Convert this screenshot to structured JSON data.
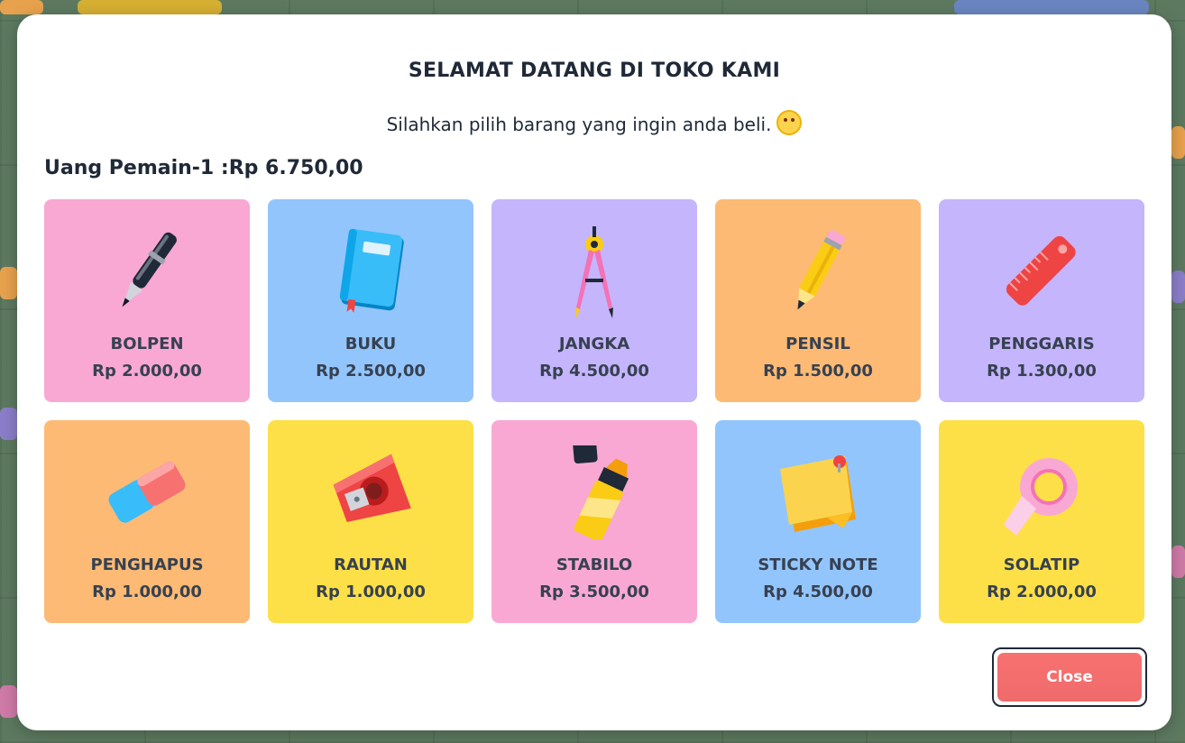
{
  "shop": {
    "title": "SELAMAT DATANG DI TOKO KAMI",
    "subtitle": "Silahkan pilih barang yang ingin anda beli.",
    "money_label": "Uang Pemain-1 :Rp 6.750,00",
    "close_label": "Close"
  },
  "items": [
    {
      "name": "BOLPEN",
      "price": "Rp 2.000,00",
      "color": "#f9a8d4",
      "icon": "pen-icon"
    },
    {
      "name": "BUKU",
      "price": "Rp 2.500,00",
      "color": "#93c5fd",
      "icon": "book-icon"
    },
    {
      "name": "JANGKA",
      "price": "Rp 4.500,00",
      "color": "#c4b5fd",
      "icon": "compass-icon"
    },
    {
      "name": "PENSIL",
      "price": "Rp 1.500,00",
      "color": "#fdba74",
      "icon": "pencil-icon"
    },
    {
      "name": "PENGGARIS",
      "price": "Rp 1.300,00",
      "color": "#c4b5fd",
      "icon": "ruler-icon"
    },
    {
      "name": "PENGHAPUS",
      "price": "Rp 1.000,00",
      "color": "#fdba74",
      "icon": "eraser-icon"
    },
    {
      "name": "RAUTAN",
      "price": "Rp 1.000,00",
      "color": "#fde047",
      "icon": "sharpener-icon"
    },
    {
      "name": "STABILO",
      "price": "Rp 3.500,00",
      "color": "#f9a8d4",
      "icon": "highlighter-icon"
    },
    {
      "name": "STICKY NOTE",
      "price": "Rp 4.500,00",
      "color": "#93c5fd",
      "icon": "sticky-note-icon"
    },
    {
      "name": "SOLATIP",
      "price": "Rp 2.000,00",
      "color": "#fde047",
      "icon": "tape-icon"
    }
  ]
}
